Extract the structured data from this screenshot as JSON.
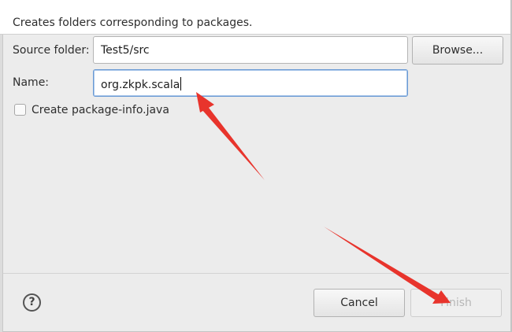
{
  "banner": {
    "description": "Creates folders corresponding to packages."
  },
  "form": {
    "source_folder_label": "Source folder:",
    "source_folder_value": "Test5/src",
    "browse_label": "Browse...",
    "name_label": "Name:",
    "name_value": "org.zkpk.scala",
    "create_package_info_label": "Create package-info.java",
    "create_package_info_checked": false
  },
  "footer": {
    "help_glyph": "?",
    "cancel_label": "Cancel",
    "finish_label": "Finish",
    "finish_enabled": false
  },
  "colors": {
    "dialog_background": "#ececec",
    "banner_background": "#ffffff",
    "focus_border": "#6a9ad4",
    "annotation_arrow": "#e8342c"
  },
  "icons": {
    "help": "question-circle-icon",
    "annotation": "red-arrow-icon"
  }
}
